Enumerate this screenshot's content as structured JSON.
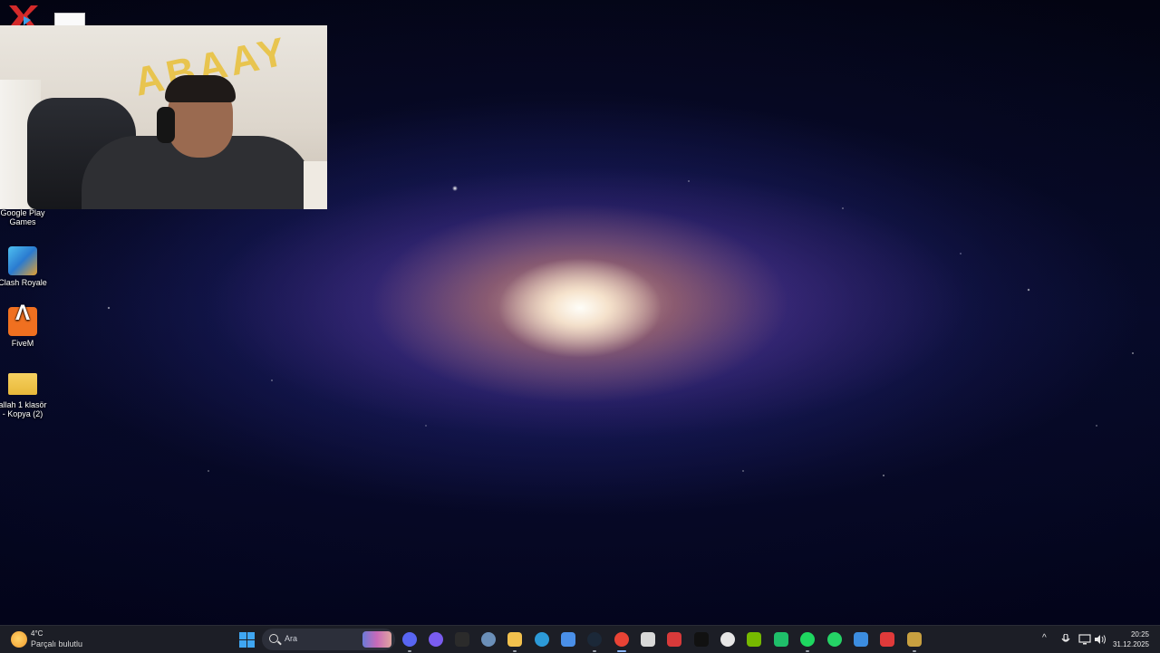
{
  "desktop": {
    "icons": [
      {
        "label": "Google Play Games"
      },
      {
        "label": "Clash Royale"
      },
      {
        "label": "FiveM"
      },
      {
        "label": "allah 1 klasör - Kopya (2)"
      }
    ]
  },
  "webcam": {
    "wall_text": "ABAAY"
  },
  "taskbar": {
    "weather": {
      "temperature": "4°C",
      "condition": "Parçalı bulutlu",
      "icon": "partly-cloudy-icon"
    },
    "search": {
      "placeholder": "Ara"
    },
    "apps": [
      {
        "name": "discord-icon",
        "color": "#5865f2"
      },
      {
        "name": "copilot-icon",
        "color": "#7a5cf0"
      },
      {
        "name": "epic-games-icon",
        "color": "#2b2b2b"
      },
      {
        "name": "settings-icon",
        "color": "#6b8fb8"
      },
      {
        "name": "file-explorer-icon",
        "color": "#f2c14e"
      },
      {
        "name": "edge-icon",
        "color": "#2c9ad8"
      },
      {
        "name": "store-icon",
        "color": "#4a8fe8"
      },
      {
        "name": "steam-icon",
        "color": "#1b2838"
      },
      {
        "name": "chrome-icon",
        "color": "#e94335"
      },
      {
        "name": "mail-icon",
        "color": "#d8d8d8"
      },
      {
        "name": "red-app-icon",
        "color": "#d83a3a"
      },
      {
        "name": "capcut-icon",
        "color": "#111111"
      },
      {
        "name": "chatgpt-icon",
        "color": "#e6e6e6"
      },
      {
        "name": "nvidia-icon",
        "color": "#76b900"
      },
      {
        "name": "android-app-icon",
        "color": "#1fbf6a"
      },
      {
        "name": "spotify-icon",
        "color": "#1ed760"
      },
      {
        "name": "whatsapp-icon",
        "color": "#25d366"
      },
      {
        "name": "image-app-icon",
        "color": "#3c8de0"
      },
      {
        "name": "recorder-icon",
        "color": "#e03a3a"
      },
      {
        "name": "paint-brush-icon",
        "color": "#c8a040"
      }
    ],
    "tray": {
      "chevron": "^"
    },
    "clock": {
      "time": "20:25",
      "date": "31.12.2025"
    }
  }
}
